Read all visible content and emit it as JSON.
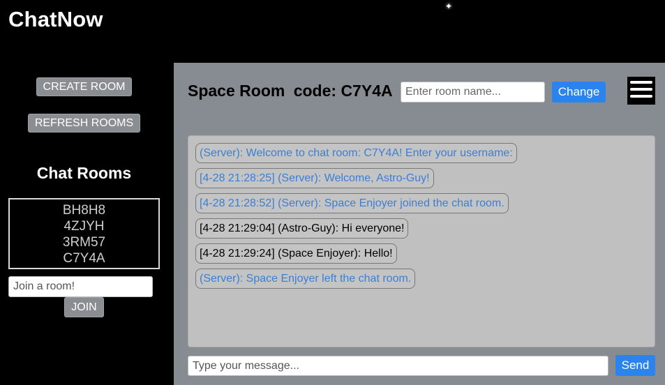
{
  "app": {
    "title": "ChatNow"
  },
  "sidebar": {
    "create_room_label": "CREATE ROOM",
    "refresh_rooms_label": "REFRESH ROOMS",
    "rooms_heading": "Chat Rooms",
    "rooms": [
      "BH8H8",
      "4ZJYH",
      "3RM57",
      "C7Y4A"
    ],
    "join_placeholder": "Join a room!",
    "join_label": "JOIN"
  },
  "chat": {
    "room_name": "Space Room",
    "code_label": "code: C7Y4A",
    "room_name_placeholder": "Enter room name...",
    "change_label": "Change",
    "menu_icon": "hamburger-menu-icon",
    "messages": [
      {
        "text": "(Server): Welcome to chat room: C7Y4A! Enter your username:",
        "kind": "server"
      },
      {
        "text": "[4-28 21:28:25] (Server): Welcome, Astro-Guy!",
        "kind": "server"
      },
      {
        "text": "[4-28 21:28:52] (Server): Space Enjoyer joined the chat room.",
        "kind": "server"
      },
      {
        "text": "[4-28 21:29:04] (Astro-Guy): Hi everyone!",
        "kind": "user"
      },
      {
        "text": "[4-28 21:29:24] (Space Enjoyer): Hello!",
        "kind": "user"
      },
      {
        "text": "(Server): Space Enjoyer left the chat room.",
        "kind": "server"
      }
    ],
    "message_placeholder": "Type your message...",
    "send_label": "Send"
  },
  "colors": {
    "background": "#000000",
    "panel": "#878b92",
    "server_text": "#3a7fd5",
    "accent_button": "#2b84ee"
  }
}
